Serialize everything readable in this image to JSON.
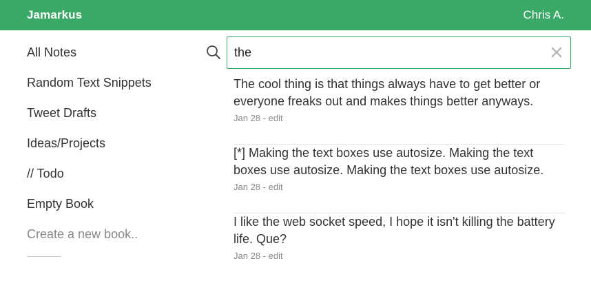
{
  "header": {
    "brand": "Jamarkus",
    "user": "Chris A."
  },
  "sidebar": {
    "books": [
      {
        "label": "All Notes"
      },
      {
        "label": "Random Text Snippets"
      },
      {
        "label": "Tweet Drafts"
      },
      {
        "label": "Ideas/Projects"
      },
      {
        "label": "// Todo"
      },
      {
        "label": "Empty Book"
      }
    ],
    "create_label": "Create a new book.."
  },
  "search": {
    "value": "the"
  },
  "notes": [
    {
      "text": "The cool thing is that things always have to get better or everyone freaks out and makes things better anyways.",
      "date": "Jan 28",
      "separator": " - ",
      "edit_label": "edit"
    },
    {
      "text": "[*] Making the text boxes use autosize. Making the text boxes use autosize. Making the text boxes use autosize.",
      "date": "Jan 28",
      "separator": " - ",
      "edit_label": "edit"
    },
    {
      "text": "I like the web socket speed, I hope it isn't killing the battery life. Que?",
      "date": "Jan 28",
      "separator": " - ",
      "edit_label": "edit"
    }
  ],
  "colors": {
    "accent": "#3aa866",
    "text": "#333333",
    "muted": "#888888"
  },
  "icons": {
    "search": "search-icon",
    "clear": "close-icon"
  }
}
